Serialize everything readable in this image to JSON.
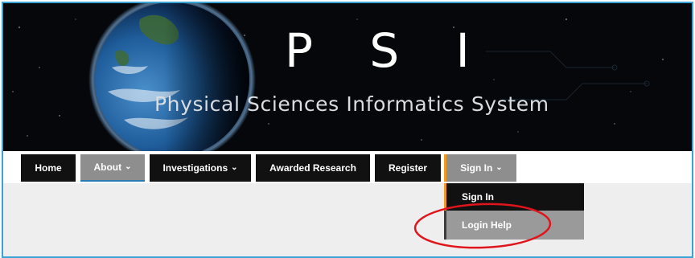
{
  "banner": {
    "title": "P S I",
    "subtitle": "Physical Sciences Informatics System"
  },
  "nav": {
    "items": [
      {
        "label": "Home",
        "has_dropdown": false
      },
      {
        "label": "About",
        "has_dropdown": true,
        "state": "active"
      },
      {
        "label": "Investigations",
        "has_dropdown": true
      },
      {
        "label": "Awarded Research",
        "has_dropdown": false
      },
      {
        "label": "Register",
        "has_dropdown": false
      },
      {
        "label": "Sign In",
        "has_dropdown": true,
        "state": "open"
      }
    ],
    "chevron": "⌄"
  },
  "dropdown": {
    "items": [
      {
        "label": "Sign In"
      },
      {
        "label": "Login Help"
      }
    ]
  },
  "colors": {
    "frame_border": "#3aa3d6",
    "accent_orange": "#f39a1e",
    "annotation_red": "#e0151c",
    "nav_dark": "#111111",
    "nav_active_gray": "#8e8e8e"
  }
}
